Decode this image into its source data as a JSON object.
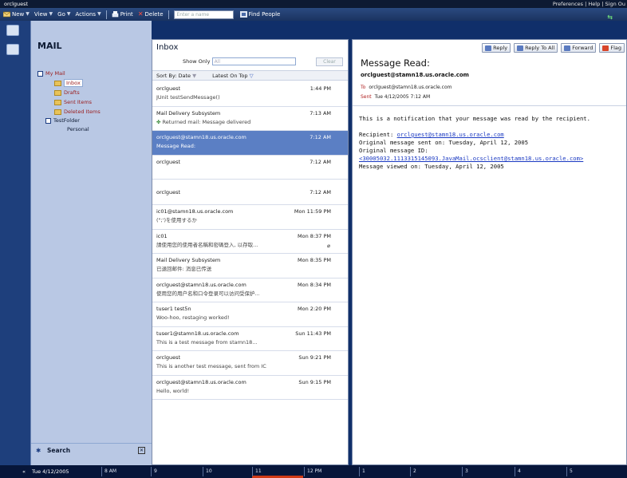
{
  "topbar": {
    "user": "orclguest",
    "links": "Preferences | Help | Sign Ou"
  },
  "toolbar": {
    "new_label": "New",
    "view_label": "View",
    "go_label": "Go",
    "actions_label": "Actions",
    "print_label": "Print",
    "delete_label": "Delete",
    "name_placeholder": "Enter a name",
    "find_people_label": "Find People"
  },
  "nav": {
    "title": "MAIL",
    "my_mail": "My Mail",
    "folders": [
      {
        "label": "Inbox"
      },
      {
        "label": "Drafts"
      },
      {
        "label": "Sent Items"
      },
      {
        "label": "Deleted Items"
      }
    ],
    "test_folder": "TestFolder",
    "personal": "Personal",
    "search_label": "Search"
  },
  "inbox": {
    "title": "Inbox",
    "show_only_label": "Show Only",
    "show_only_value": "All",
    "clear_label": "Clear",
    "sort_label": "Sort By: Date",
    "latest_label": "Latest On Top",
    "messages": [
      {
        "from": "orclguest",
        "date": "1:44 PM",
        "subject": "JUnit testSendMessage()"
      },
      {
        "from": "Mail Delivery Subsystem",
        "date": "7:13 AM",
        "subject": "Returned mail: Message delivered"
      },
      {
        "from": "orclguest@stamn18.us.oracle.com",
        "date": "7:12 AM",
        "subject": "Message Read:"
      },
      {
        "from": "orclguest",
        "date": "7:12 AM",
        "subject": ""
      },
      {
        "from": "orclguest",
        "date": "7:12 AM",
        "subject": ""
      },
      {
        "from": "ic01@stamn18.us.oracle.com",
        "date": "Mon 11:59 PM",
        "subject": "(\";')を使用するか"
      },
      {
        "from": "ic01",
        "date": "Mon 8:37 PM",
        "subject": "請使用您的使用者名稱和密碼登入, 以存取..."
      },
      {
        "from": "Mail Delivery Subsystem",
        "date": "Mon 8:35 PM",
        "subject": "已退回邮件: 消息已传送"
      },
      {
        "from": "orclguest@stamn18.us.oracle.com",
        "date": "Mon 8:34 PM",
        "subject": "使用您的用户名和口令登录可以访问受保护..."
      },
      {
        "from": "tuser1 test5n",
        "date": "Mon 2:20 PM",
        "subject": "Woo-hoo, restaging worked!"
      },
      {
        "from": "tuser1@stamn18.us.oracle.com",
        "date": "Sun 11:43 PM",
        "subject": "This is a test message from stamn18..."
      },
      {
        "from": "orclguest",
        "date": "Sun 9:21 PM",
        "subject": "This is another test message, sent from IC"
      },
      {
        "from": "orclguest@stamn18.us.oracle.com",
        "date": "Sun 9:15 PM",
        "subject": "Hello, world!"
      }
    ]
  },
  "reader": {
    "buttons": {
      "reply": "Reply",
      "reply_all": "Reply To All",
      "forward": "Forward",
      "flag": "Flag"
    },
    "subject": "Message Read:",
    "sender": "orclguest@stamn18.us.oracle.com",
    "to_label": "To",
    "to_value": "orclguest@stamn18.us.oracle.com",
    "sent_label": "Sent",
    "sent_value": "Tue 4/12/2005 7:12 AM",
    "body_intro": "This is a notification that your message was read by the recipient.",
    "recipient_label": "Recipient: ",
    "recipient_link": "orclguest@stamn18.us.oracle.com",
    "orig_sent": "Original message sent on: Tuesday, April 12, 2005",
    "orig_id_label": "Original message ID:",
    "orig_id_link": "<30005032.1113315145093.JavaMail.ocsclient@stamn18.us.oracle.com>",
    "viewed": "Message viewed on: Tuesday, April 12, 2005"
  },
  "timeline": {
    "date": "Tue 4/12/2005",
    "hours": [
      "8 AM",
      "9",
      "10",
      "11",
      "12 PM",
      "1",
      "2",
      "3",
      "4",
      "5"
    ]
  }
}
